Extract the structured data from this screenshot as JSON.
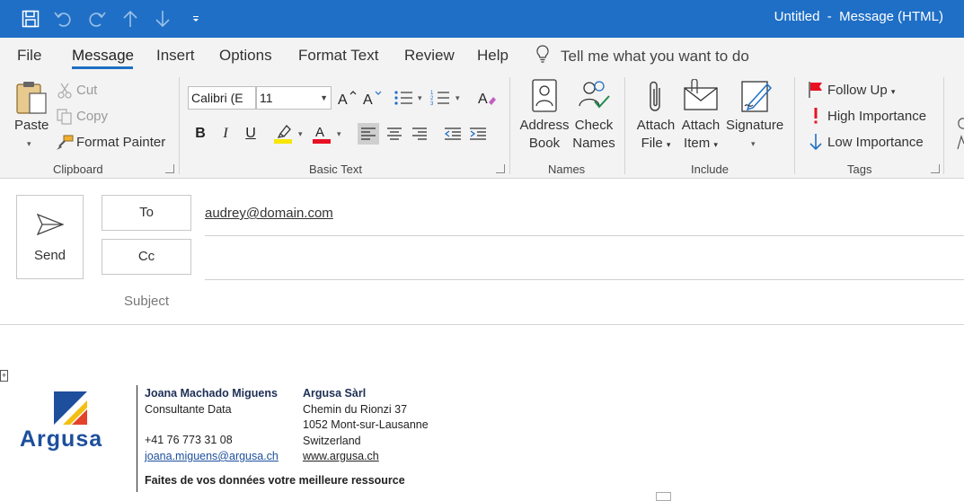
{
  "window": {
    "title": "Untitled  -  Message (HTML)"
  },
  "tabs": [
    "File",
    "Message",
    "Insert",
    "Options",
    "Format Text",
    "Review",
    "Help"
  ],
  "tellme": "Tell me what you want to do",
  "clipboard": {
    "paste": "Paste",
    "cut": "Cut",
    "copy": "Copy",
    "format_painter": "Format Painter",
    "label": "Clipboard"
  },
  "basic_text": {
    "font": "Calibri (E",
    "size": "11",
    "bold": "B",
    "italic": "I",
    "underline": "U",
    "label": "Basic Text",
    "highlight_color": "#f6e600",
    "font_color": "#e81123"
  },
  "names": {
    "address_book": [
      "Address",
      "Book"
    ],
    "check_names": [
      "Check",
      "Names"
    ],
    "label": "Names"
  },
  "include": {
    "attach_file": [
      "Attach",
      "File"
    ],
    "attach_item": [
      "Attach",
      "Item"
    ],
    "signature": "Signature",
    "label": "Include"
  },
  "tags": {
    "follow_up": "Follow Up",
    "high_importance": "High Importance",
    "low_importance": "Low Importance",
    "label": "Tags"
  },
  "compose": {
    "send": "Send",
    "to_label": "To",
    "cc_label": "Cc",
    "subject_label": "Subject",
    "to_value": "audrey@domain.com"
  },
  "signature_block": {
    "logo_text": "Argusa",
    "name": "Joana Machado Miguens",
    "role": "Consultante Data",
    "phone": "+41 76 773 31 08",
    "email": "joana.miguens@argusa.ch",
    "company": "Argusa Sàrl",
    "street": "Chemin du Rionzi 37",
    "city": "1052 Mont-sur-Lausanne",
    "country": "Switzerland",
    "website": "www.argusa.ch",
    "tagline": "Faites de vos données votre meilleure ressource"
  },
  "colors": {
    "title_bar": "#1f6fc6",
    "ribbon": "#f3f3f3",
    "accent": "#1f6fc6",
    "follow_up_flag": "#e81123",
    "logo_blue": "#1d4f9c",
    "logo_yellow": "#f2c012",
    "logo_red": "#e3432b"
  }
}
